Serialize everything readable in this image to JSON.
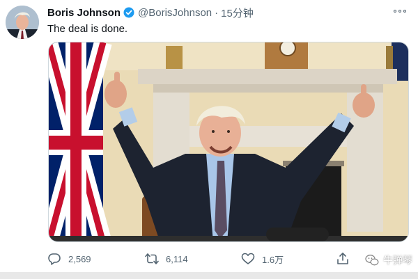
{
  "tweet": {
    "author_name": "Boris Johnson",
    "handle": "@BorisJohnson",
    "separator": "·",
    "time": "15分钟",
    "text": "The deal is done.",
    "verified": true
  },
  "actions": {
    "replies": "2,569",
    "retweets": "6,114",
    "likes": "1.6万"
  },
  "watermark": {
    "text": "牛弹琴"
  },
  "icons": {
    "verified": "verified-badge-icon",
    "more": "more-options-icon",
    "reply": "reply-icon",
    "retweet": "retweet-icon",
    "like": "heart-icon",
    "share": "share-icon",
    "watermark": "wechat-icon"
  },
  "colors": {
    "verified_blue": "#1d9bf0",
    "text_primary": "#0f1419",
    "text_secondary": "#536471",
    "union_red": "#c8102e",
    "union_blue": "#012169"
  }
}
